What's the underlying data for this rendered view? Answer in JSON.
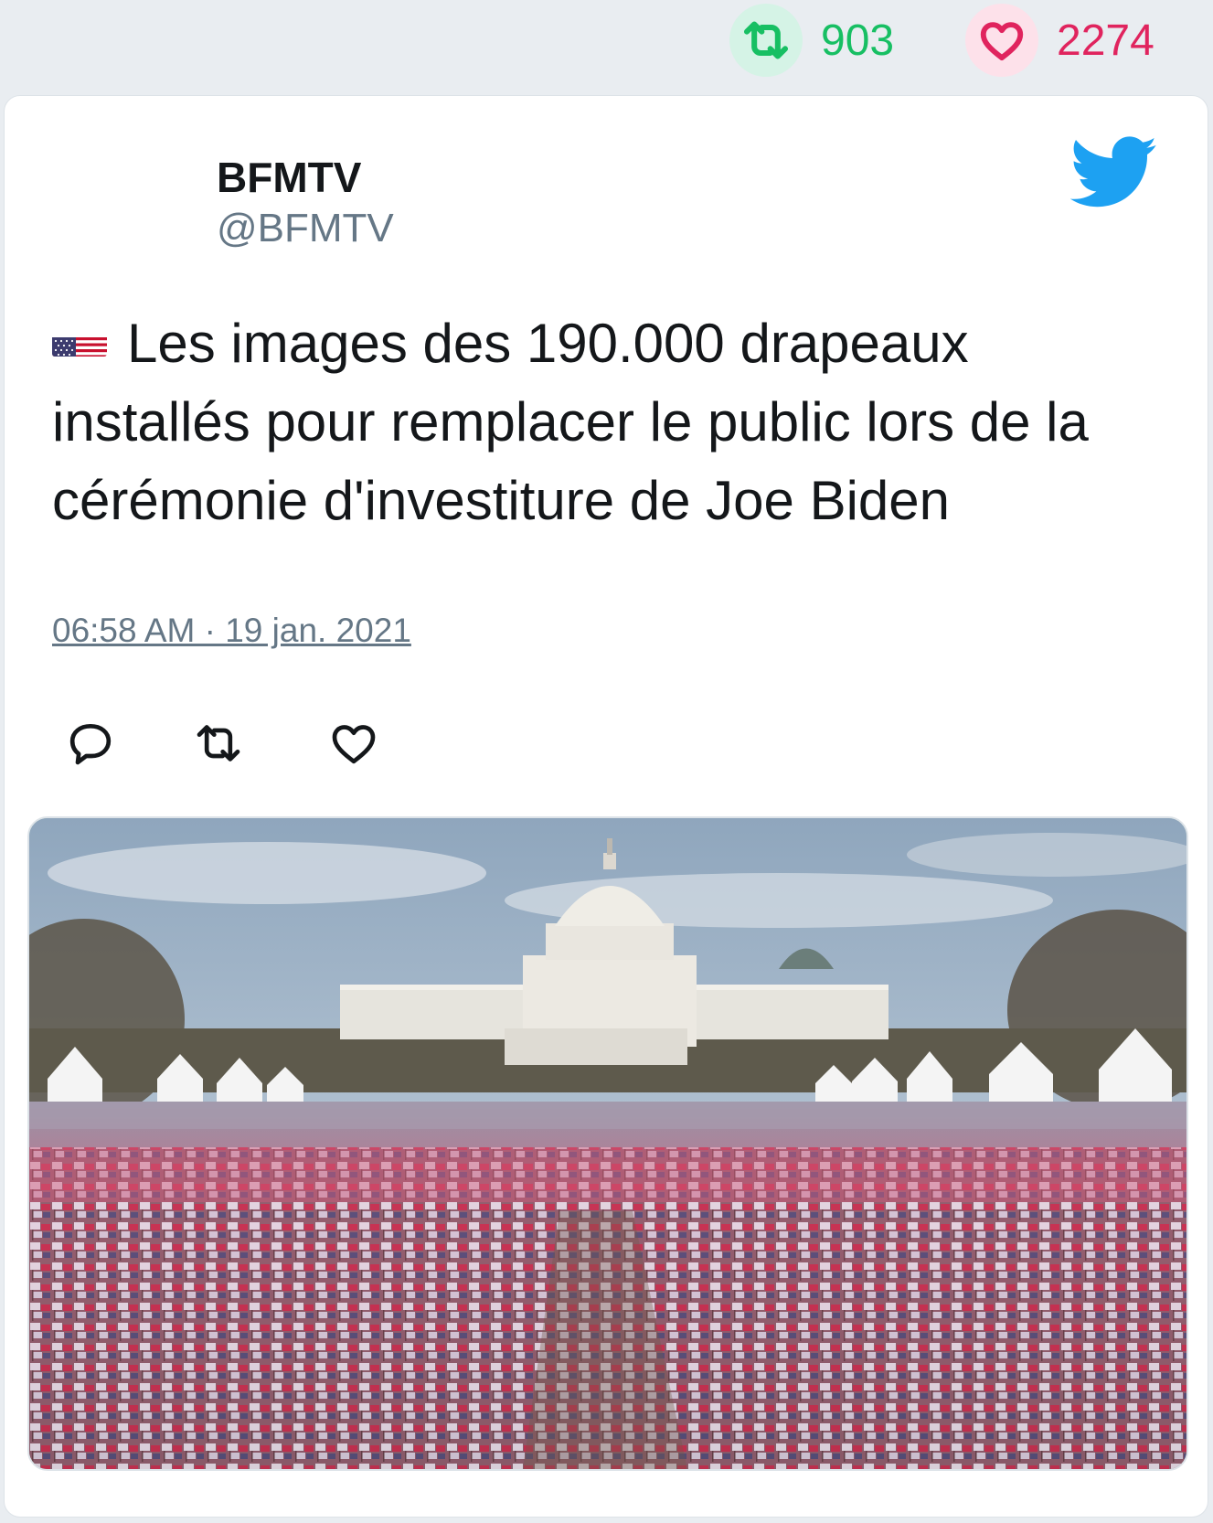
{
  "stats": {
    "retweet_icon": "retweet-icon",
    "retweet_count": "903",
    "like_icon": "heart-icon",
    "like_count": "2274"
  },
  "tweet": {
    "author_name": "BFMTV",
    "author_handle": "@BFMTV",
    "brand_icon": "twitter-bird-icon",
    "flag_icon": "us-flag-emoji",
    "text": "Les images des 190.000 drapeaux installés pour remplacer le public lors de la cérémonie d'investiture de Joe Biden",
    "timestamp": "06:58 AM · 19 jan. 2021",
    "actions": [
      "reply-icon",
      "retweet-icon",
      "like-icon"
    ],
    "media_alt": "photo of flags on the National Mall in front of the US Capitol"
  },
  "colors": {
    "retweet": "#17bf63",
    "like": "#e0245e",
    "twitter_blue": "#1da1f2",
    "secondary_text": "#657786"
  }
}
